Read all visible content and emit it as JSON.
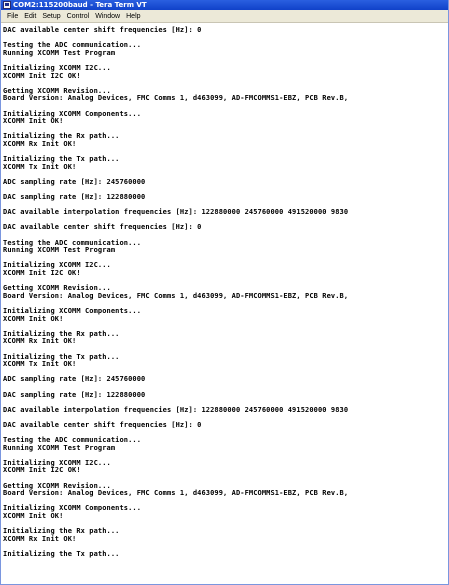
{
  "window": {
    "title": "COM2:115200baud - Tera Term VT"
  },
  "menu": [
    "File",
    "Edit",
    "Setup",
    "Control",
    "Window",
    "Help"
  ],
  "terminal": {
    "lines": [
      "DAC available center shift frequencies [Hz]: 0",
      "",
      "Testing the ADC communication...",
      "Running XCOMM Test Program",
      "",
      "Initializing XCOMM I2C...",
      "XCOMM Init I2C OK!",
      "",
      "Getting XCOMM Revision...",
      "Board Version: Analog Devices, FMC Comms 1, d463099, AD-FMCOMMS1-EBZ, PCB Rev.B,",
      "",
      "Initializing XCOMM Components...",
      "XCOMM Init OK!",
      "",
      "Initializing the Rx path...",
      "XCOMM Rx Init OK!",
      "",
      "Initializing the Tx path...",
      "XCOMM Tx Init OK!",
      "",
      "ADC sampling rate [Hz]: 245760000",
      "",
      "DAC sampling rate [Hz]: 122880000",
      "",
      "DAC available interpolation frequencies [Hz]: 122880000 245760000 491520000 9830",
      "",
      "DAC available center shift frequencies [Hz]: 0",
      "",
      "Testing the ADC communication...",
      "Running XCOMM Test Program",
      "",
      "Initializing XCOMM I2C...",
      "XCOMM Init I2C OK!",
      "",
      "Getting XCOMM Revision...",
      "Board Version: Analog Devices, FMC Comms 1, d463099, AD-FMCOMMS1-EBZ, PCB Rev.B,",
      "",
      "Initializing XCOMM Components...",
      "XCOMM Init OK!",
      "",
      "Initializing the Rx path...",
      "XCOMM Rx Init OK!",
      "",
      "Initializing the Tx path...",
      "XCOMM Tx Init OK!",
      "",
      "ADC sampling rate [Hz]: 245760000",
      "",
      "DAC sampling rate [Hz]: 122880000",
      "",
      "DAC available interpolation frequencies [Hz]: 122880000 245760000 491520000 9830",
      "",
      "DAC available center shift frequencies [Hz]: 0",
      "",
      "Testing the ADC communication...",
      "Running XCOMM Test Program",
      "",
      "Initializing XCOMM I2C...",
      "XCOMM Init I2C OK!",
      "",
      "Getting XCOMM Revision...",
      "Board Version: Analog Devices, FMC Comms 1, d463099, AD-FMCOMMS1-EBZ, PCB Rev.B,",
      "",
      "Initializing XCOMM Components...",
      "XCOMM Init OK!",
      "",
      "Initializing the Rx path...",
      "XCOMM Rx Init OK!",
      "",
      "Initializing the Tx path..."
    ]
  }
}
